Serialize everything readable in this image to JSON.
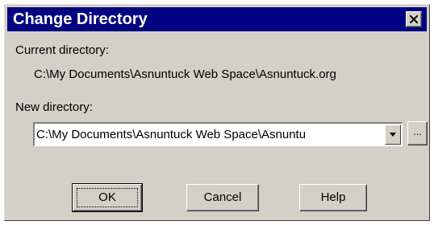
{
  "dialog": {
    "title": "Change Directory",
    "close_glyph": "×"
  },
  "current": {
    "label": "Current directory:",
    "value": "C:\\My Documents\\Asnuntuck Web Space\\Asnuntuck.org"
  },
  "new_dir": {
    "label": "New directory:",
    "value": "C:\\My Documents\\Asnuntuck Web Space\\Asnuntu",
    "browse_label": "..."
  },
  "buttons": {
    "ok": "OK",
    "cancel": "Cancel",
    "help": "Help"
  },
  "colors": {
    "titlebar": "#000080",
    "face": "#d4d0c8"
  },
  "icons": {
    "close": "close-icon",
    "dropdown": "chevron-down-icon"
  }
}
